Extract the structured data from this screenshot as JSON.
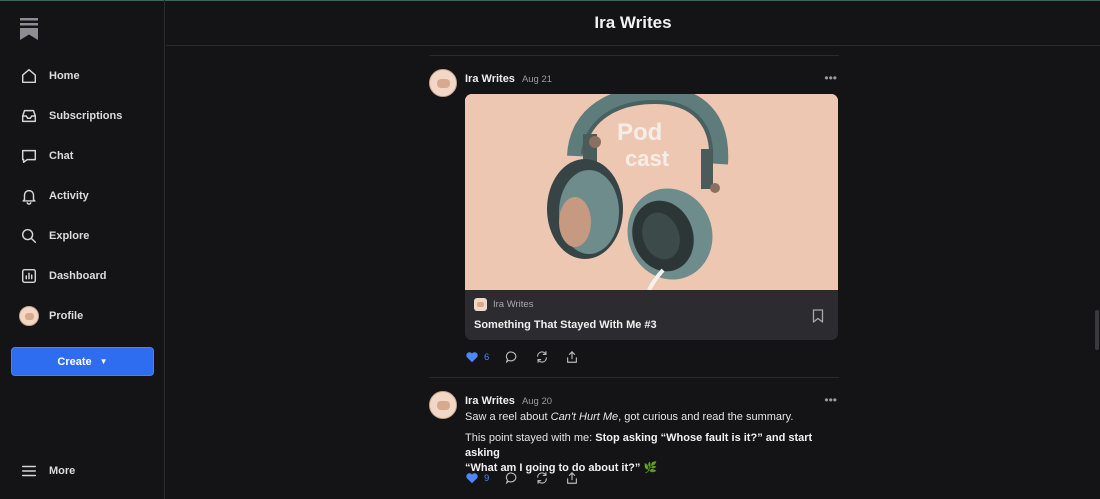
{
  "app": {
    "header_title": "Ira Writes"
  },
  "sidebar": {
    "items": [
      {
        "label": "Home",
        "icon": "home-icon"
      },
      {
        "label": "Subscriptions",
        "icon": "inbox-icon"
      },
      {
        "label": "Chat",
        "icon": "chat-icon"
      },
      {
        "label": "Activity",
        "icon": "bell-icon"
      },
      {
        "label": "Explore",
        "icon": "search-icon"
      },
      {
        "label": "Dashboard",
        "icon": "dashboard-icon"
      },
      {
        "label": "Profile",
        "icon": "avatar"
      }
    ],
    "create_label": "Create",
    "more_label": "More"
  },
  "posts": [
    {
      "author": "Ira Writes",
      "date": "Aug 21",
      "card": {
        "art_text_line1": "Pod",
        "art_text_line2": "cast",
        "publication": "Ira Writes",
        "title": "Something That Stayed With Me #3"
      },
      "likes": "6"
    },
    {
      "author": "Ira Writes",
      "date": "Aug 20",
      "text_1_pre": "Saw a reel about ",
      "text_1_em": "Can't Hurt Me",
      "text_1_post": ", got curious and read the summary.",
      "text_2_pre": "This point stayed with me: ",
      "text_2_bold_a": "Stop asking “Whose fault is it?” and start asking",
      "text_2_bold_b": "“What am I going to do about it?”",
      "text_2_emoji": "🌿",
      "likes": "9"
    }
  ],
  "colors": {
    "accent": "#2f6df0",
    "like": "#4d86f7",
    "art_bg": "#eec7b3"
  }
}
